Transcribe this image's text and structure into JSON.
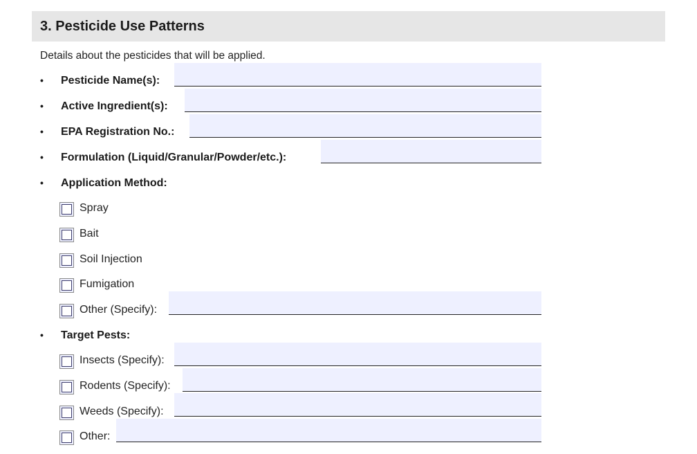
{
  "section": {
    "title": "3. Pesticide Use Patterns",
    "intro": "Details about the pesticides that will be applied."
  },
  "fields": {
    "bullet": "•",
    "pesticide_name": {
      "label": "Pesticide Name(s):",
      "value": ""
    },
    "active_ingredient": {
      "label": "Active Ingredient(s):",
      "value": ""
    },
    "epa_registration": {
      "label": "EPA Registration No.:",
      "value": ""
    },
    "formulation": {
      "label": "Formulation (Liquid/Granular/Powder/etc.):",
      "value": ""
    }
  },
  "application_method": {
    "label": "Application Method:",
    "options": {
      "spray": {
        "label": "Spray",
        "checked": false
      },
      "bait": {
        "label": "Bait",
        "checked": false
      },
      "soil_injection": {
        "label": "Soil Injection",
        "checked": false
      },
      "fumigation": {
        "label": "Fumigation",
        "checked": false
      },
      "other": {
        "label": "Other (Specify):",
        "checked": false,
        "value": ""
      }
    }
  },
  "target_pests": {
    "label": "Target Pests:",
    "options": {
      "insects": {
        "label": "Insects (Specify):",
        "checked": false,
        "value": ""
      },
      "rodents": {
        "label": "Rodents (Specify):",
        "checked": false,
        "value": ""
      },
      "weeds": {
        "label": "Weeds (Specify):",
        "checked": false,
        "value": ""
      },
      "other": {
        "label": "Other:",
        "checked": false,
        "value": ""
      }
    }
  }
}
